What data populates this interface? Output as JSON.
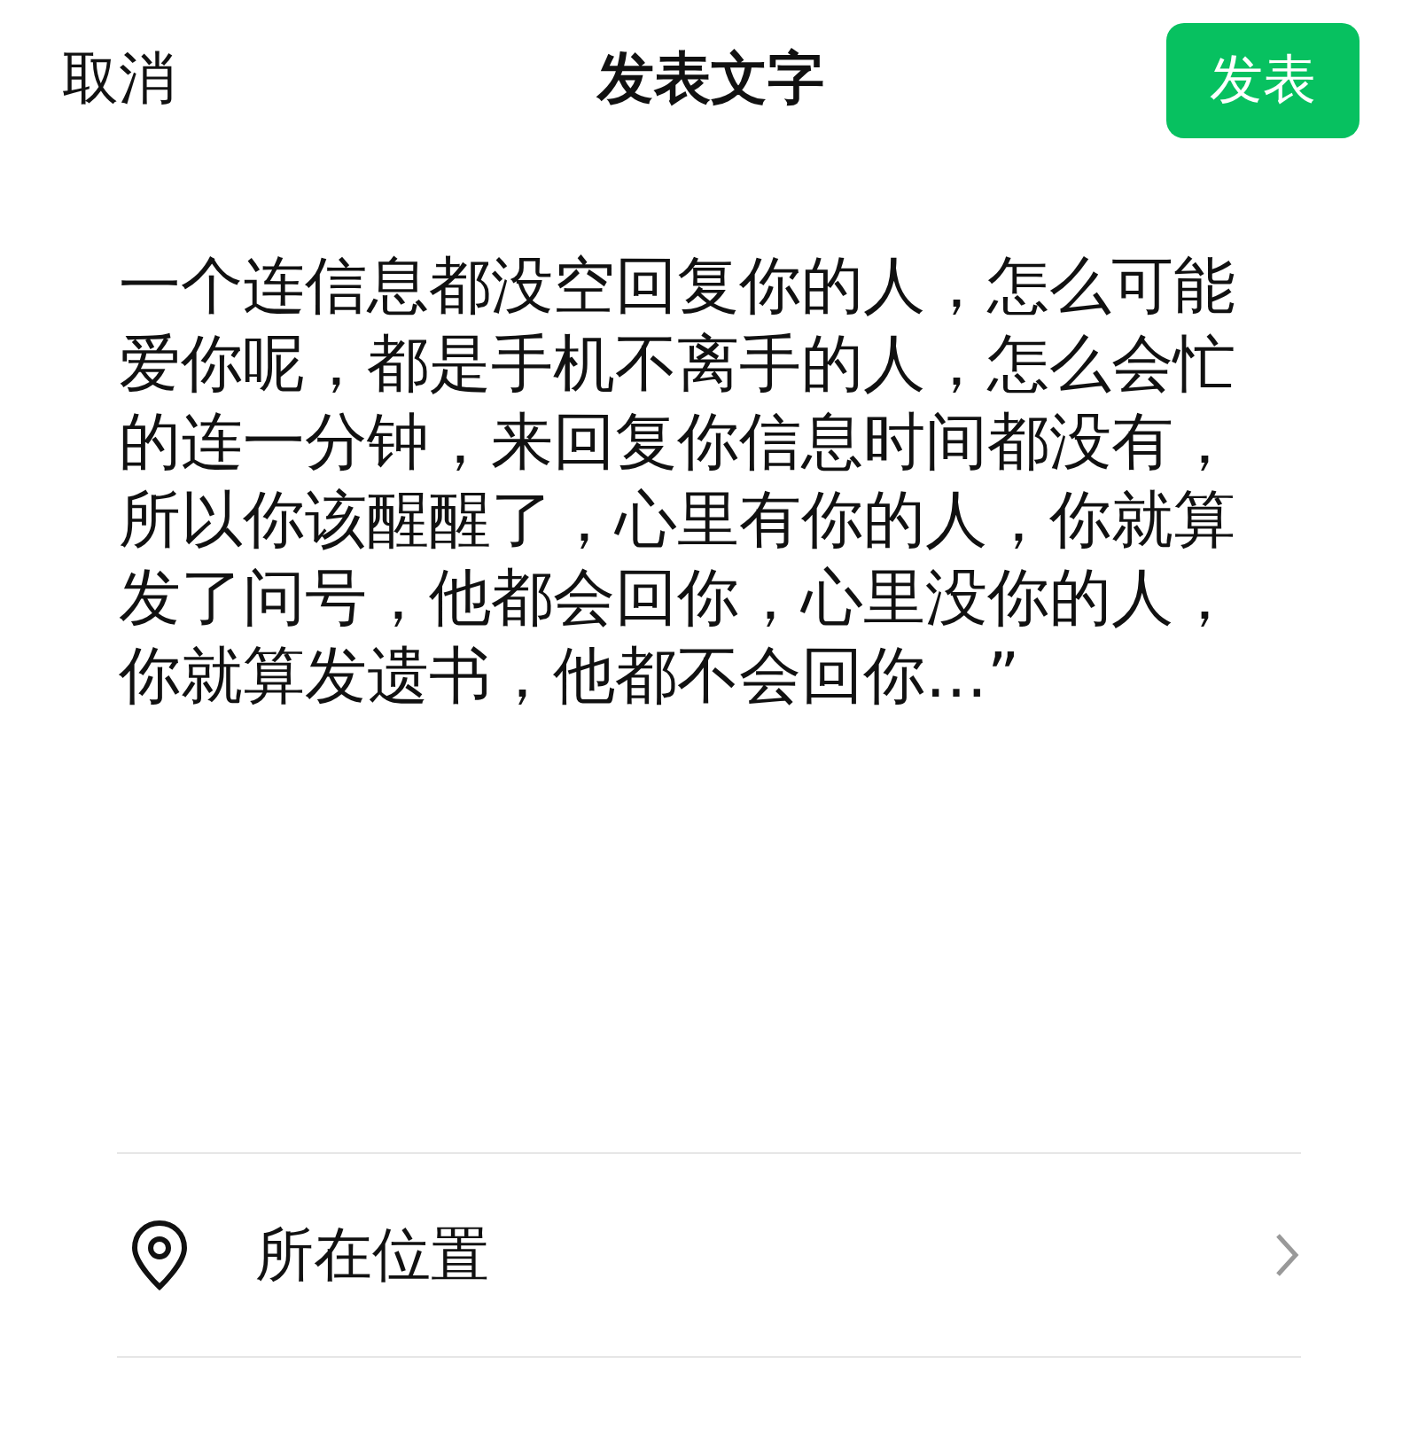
{
  "header": {
    "cancel": "取消",
    "title": "发表文字",
    "publish": "发表"
  },
  "post_text": "一个连信息都没空回复你的人，怎么可能爱你呢，都是手机不离手的人，怎么会忙的连一分钟，来回复你信息时间都没有，所以你该醒醒了，心里有你的人，你就算发了问号，他都会回你，心里没你的人，你就算发遗书，他都不会回你…”",
  "options": [
    {
      "kind": "location",
      "label": "所在位置"
    }
  ]
}
